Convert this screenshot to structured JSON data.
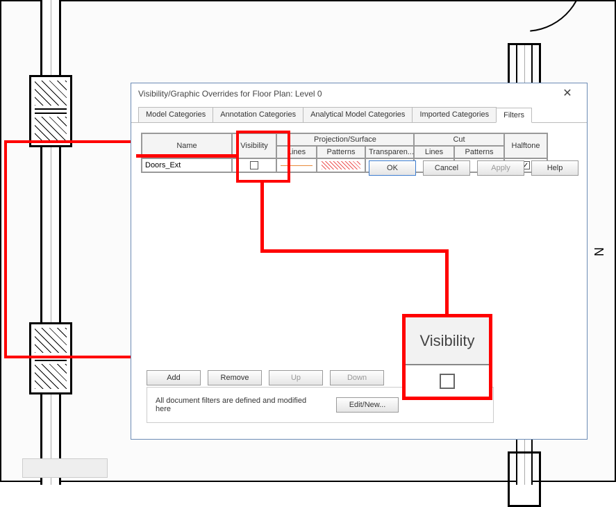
{
  "dialog": {
    "title": "Visibility/Graphic Overrides for Floor Plan: Level 0"
  },
  "tabs": {
    "model": "Model Categories",
    "annotation": "Annotation Categories",
    "analytical": "Analytical Model Categories",
    "imported": "Imported Categories",
    "filters": "Filters"
  },
  "grid": {
    "headers": {
      "name": "Name",
      "visibility": "Visibility",
      "projection": "Projection/Surface",
      "cut": "Cut",
      "halftone": "Halftone",
      "lines": "Lines",
      "patterns": "Patterns",
      "transparency": "Transparen..."
    },
    "rows": [
      {
        "name": "Doors_Ext",
        "visibility": false,
        "halftone": true
      }
    ]
  },
  "buttons": {
    "add": "Add",
    "remove": "Remove",
    "up": "Up",
    "down": "Down",
    "editnew": "Edit/New...",
    "ok": "OK",
    "cancel": "Cancel",
    "apply": "Apply",
    "help": "Help"
  },
  "hint": "All document filters are defined and modified here",
  "zoom": {
    "label": "Visibility"
  },
  "north": "N"
}
